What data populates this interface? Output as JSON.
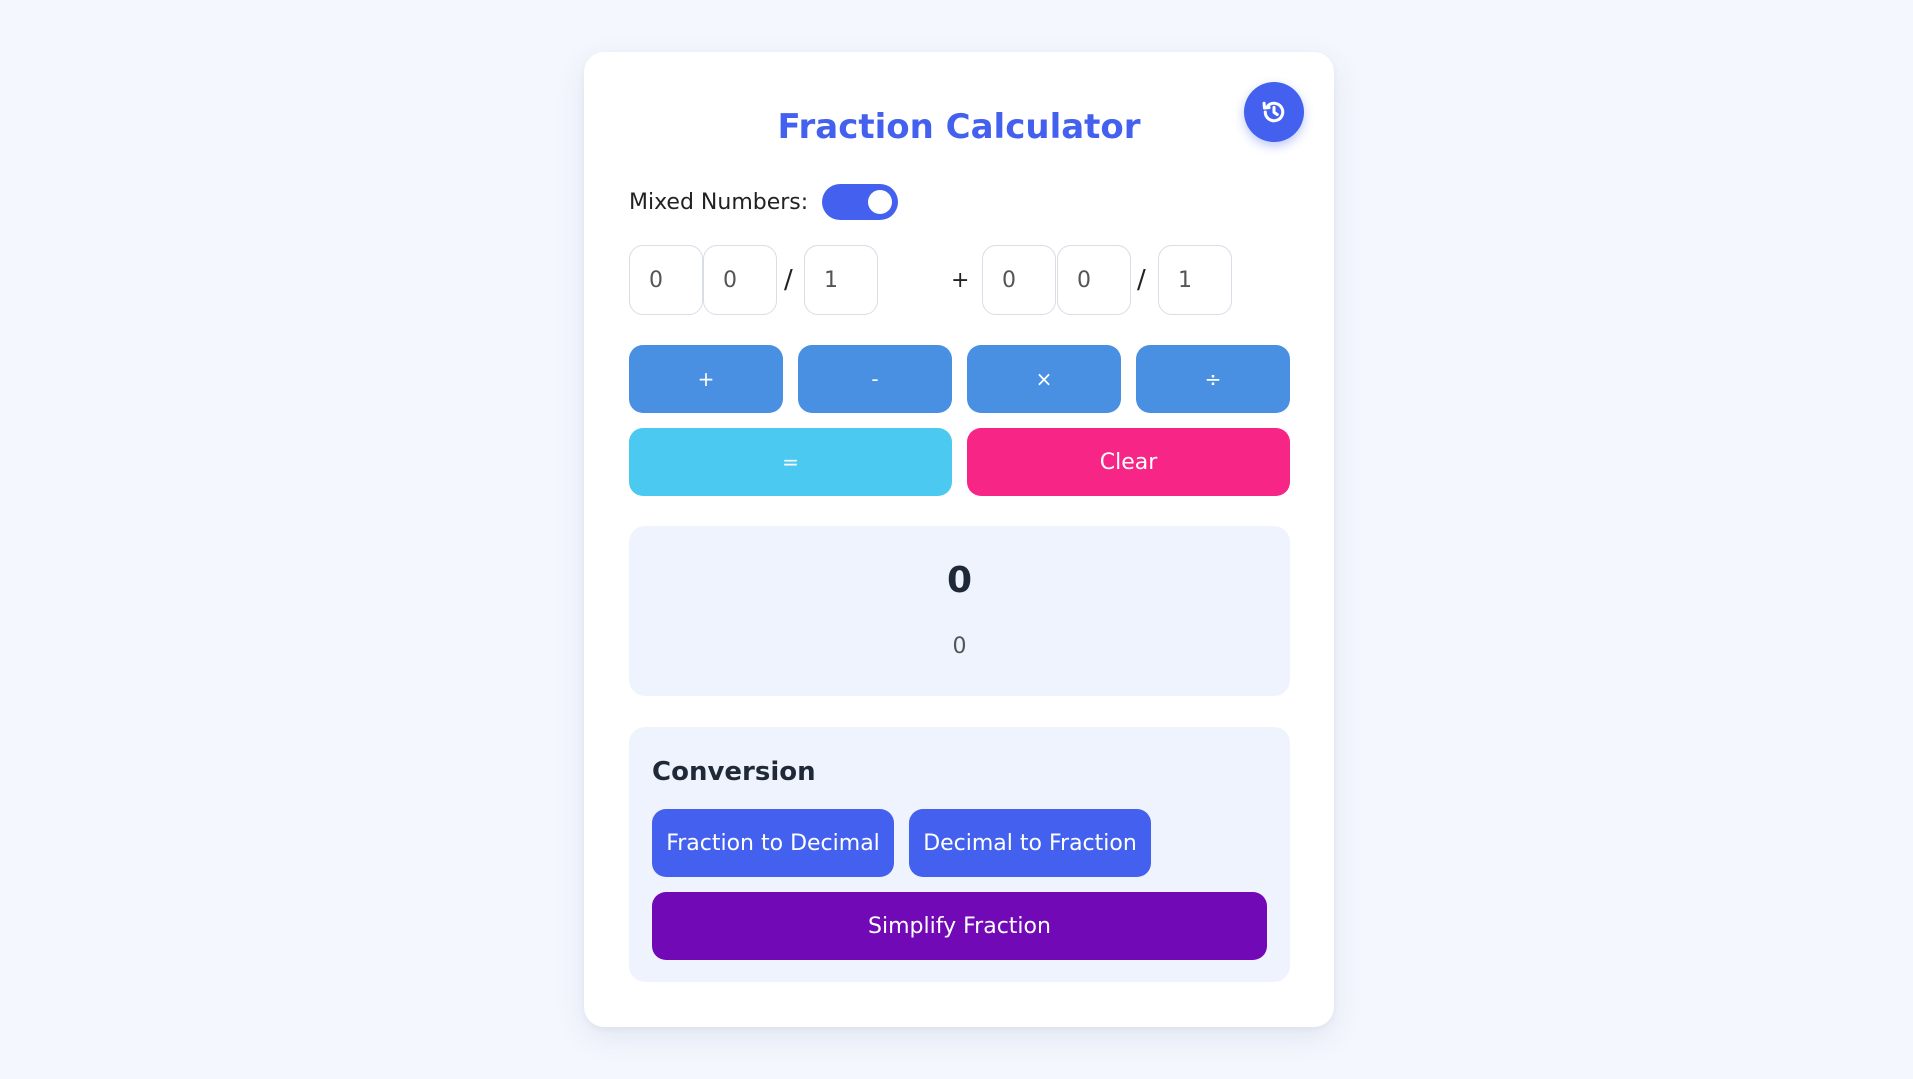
{
  "app": {
    "title": "Fraction Calculator",
    "history_icon": "history-icon"
  },
  "mixed": {
    "label": "Mixed Numbers:",
    "enabled": true
  },
  "fraction1": {
    "whole": "0",
    "numerator": "0",
    "denominator": "1"
  },
  "fraction2": {
    "whole": "0",
    "numerator": "0",
    "denominator": "1"
  },
  "separator": "/",
  "current_operator": "+",
  "operations": {
    "add": "+",
    "subtract": "-",
    "multiply": "×",
    "divide": "÷",
    "equals": "=",
    "clear": "Clear"
  },
  "result": {
    "main": "0",
    "decimal": "0"
  },
  "conversion": {
    "title": "Conversion",
    "to_decimal": "Fraction to Decimal",
    "to_fraction": "Decimal to Fraction",
    "simplify": "Simplify Fraction"
  },
  "colors": {
    "primary": "#4361ee",
    "operator_button": "#4a90e2",
    "equals_button": "#4cc9f0",
    "clear_button": "#f72585",
    "simplify_button": "#7209b7",
    "panel_background": "#eff3fd",
    "page_background": "#f4f7fd"
  }
}
